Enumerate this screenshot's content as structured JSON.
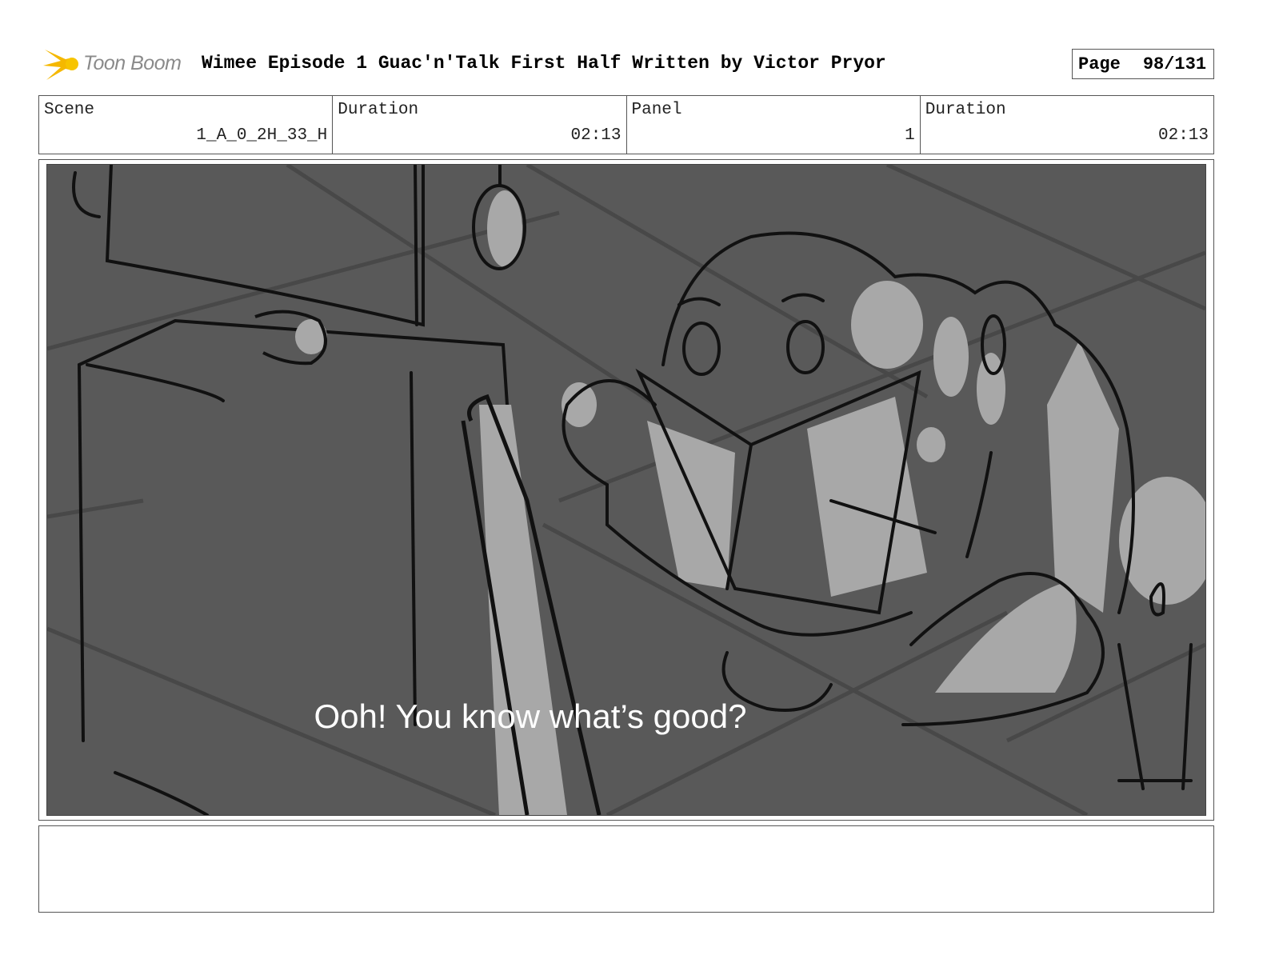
{
  "header": {
    "logo_text": "Toon Boom",
    "title": "Wimee Episode 1 Guac'n'Talk First Half  Written by Victor Pryor",
    "page_label": "Page",
    "page_value": "98/131"
  },
  "info": {
    "scene_label": "Scene",
    "scene_value": "1_A_0_2H_33_H",
    "duration_label": "Duration",
    "duration_value": "02:13",
    "panel_label": "Panel",
    "panel_value": "1",
    "panel_duration_label": "Duration",
    "panel_duration_value": "02:13"
  },
  "panel": {
    "caption": "Ooh! You know what’s good?"
  },
  "colors": {
    "logo_accent": "#f5b800",
    "panel_background": "#595959",
    "sketch_light": "#a8a8a8",
    "sketch_line": "#111111"
  },
  "icons": {
    "logo": "toon-boom-burst-icon"
  }
}
